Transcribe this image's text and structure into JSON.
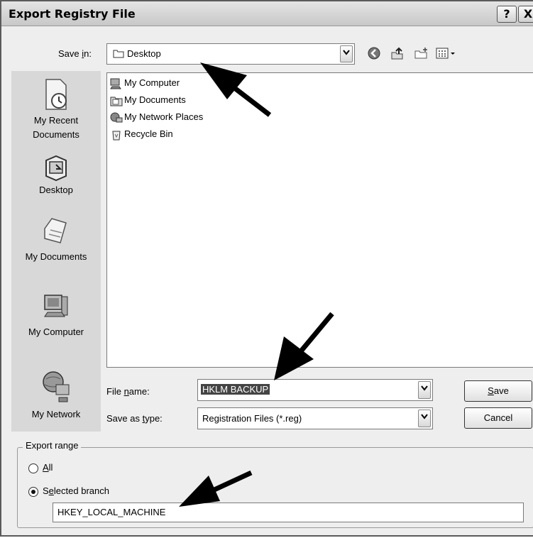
{
  "dialog": {
    "title": "Export Registry File",
    "help_glyph": "?",
    "close_glyph": "X"
  },
  "save_in": {
    "label_pre": "Save ",
    "label_key": "i",
    "label_post": "n:",
    "value": "Desktop",
    "toolbar_icons": [
      "back-icon",
      "up-folder-icon",
      "new-folder-icon",
      "views-menu-icon"
    ]
  },
  "places_bar": [
    {
      "label": "My Recent Documents",
      "line1": "My Recent",
      "line2": "Documents",
      "icon": "recent-documents-icon"
    },
    {
      "label": "Desktop",
      "icon": "desktop-icon"
    },
    {
      "label": "My Documents",
      "icon": "my-documents-icon"
    },
    {
      "label": "My Computer",
      "icon": "my-computer-icon"
    },
    {
      "label": "My Network",
      "icon": "my-network-icon"
    }
  ],
  "file_list": [
    {
      "name": "My Computer",
      "icon": "computer-icon"
    },
    {
      "name": "My Documents",
      "icon": "documents-folder-icon"
    },
    {
      "name": "My Network Places",
      "icon": "network-places-icon"
    },
    {
      "name": "Recycle Bin",
      "icon": "recycle-bin-icon"
    }
  ],
  "file_name": {
    "label_pre": "File ",
    "label_key": "n",
    "label_post": "ame:",
    "value": "HKLM BACKUP"
  },
  "save_as_type": {
    "label_pre": "Save as ",
    "label_key": "t",
    "label_post": "ype:",
    "value": "Registration Files (*.reg)"
  },
  "buttons": {
    "save_key": "S",
    "save_rest": "ave",
    "cancel": "Cancel"
  },
  "export_range": {
    "title": "Export range",
    "all_key": "A",
    "all_rest": "ll",
    "selected_pre": "S",
    "selected_key": "e",
    "selected_rest": "lected branch",
    "selected": "selected_branch",
    "branch_value": "HKEY_LOCAL_MACHINE"
  }
}
